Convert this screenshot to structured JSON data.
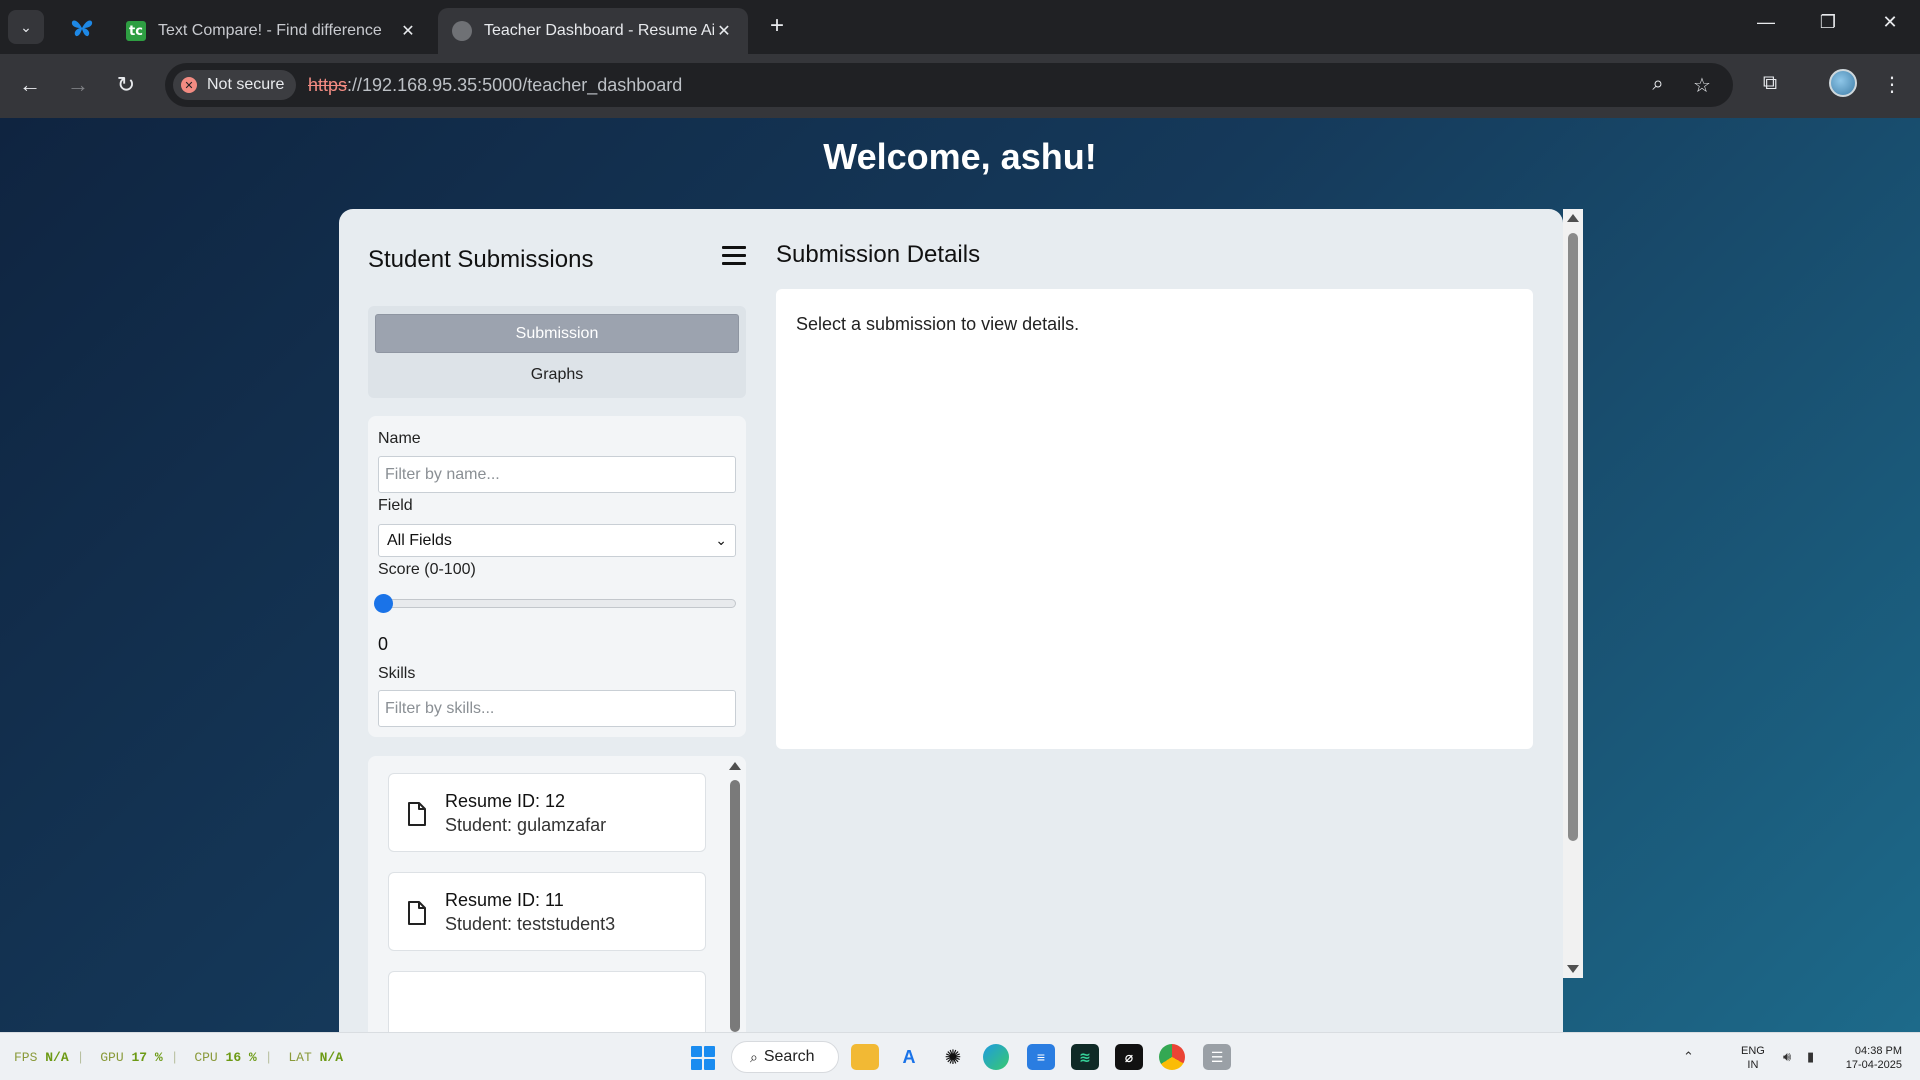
{
  "browser": {
    "tabs": [
      {
        "title": "Text Compare! - Find difference",
        "favicon_text": "tc"
      },
      {
        "title": "Teacher Dashboard - Resume Ai"
      }
    ],
    "security_label": "Not secure",
    "url_scheme": "https",
    "url_rest": "://192.168.95.35:5000/teacher_dashboard"
  },
  "page": {
    "welcome": "Welcome, ashu!",
    "sidebar": {
      "title": "Student Submissions",
      "nav": {
        "submission": "Submission",
        "graphs": "Graphs"
      },
      "filters": {
        "name_label": "Name",
        "name_placeholder": "Filter by name...",
        "field_label": "Field",
        "field_value": "All Fields",
        "score_label": "Score (0-100)",
        "score_value": "0",
        "score_fraction": 0,
        "skills_label": "Skills",
        "skills_placeholder": "Filter by skills..."
      },
      "submissions": [
        {
          "id": "Resume ID: 12",
          "student": "Student: gulamzafar"
        },
        {
          "id": "Resume ID: 11",
          "student": "Student: teststudent3"
        }
      ]
    },
    "details": {
      "title": "Submission Details",
      "empty_message": "Select a submission to view details."
    }
  },
  "taskbar": {
    "perf": {
      "fps_label": "FPS",
      "fps": "N/A",
      "gpu_label": "GPU",
      "gpu": "17 %",
      "cpu_label": "CPU",
      "cpu": "16 %",
      "lat_label": "LAT",
      "lat": "N/A"
    },
    "search": "Search",
    "lang_top": "ENG",
    "lang_bottom": "IN",
    "time": "04:38 PM",
    "date": "17-04-2025"
  },
  "colors": {
    "accent": "#1a73e8",
    "tab_active_bg": "#9ca3af",
    "bg_gradient_start": "#0f2440",
    "bg_gradient_end": "#1d6a8a"
  }
}
